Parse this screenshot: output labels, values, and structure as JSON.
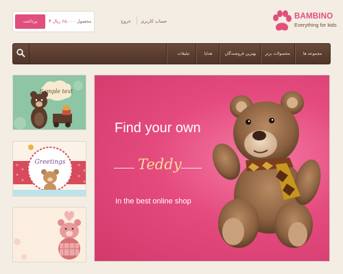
{
  "header": {
    "pay_label": "پرداخت",
    "cart_count": "۳ محصول",
    "cart_total": "۶۵,۰۰۰ ریال",
    "logout_label": "خروج",
    "account_label": "حساب کاربری",
    "logo_title": "BAMBINO",
    "logo_tagline": "Everything for kids"
  },
  "nav": {
    "items": [
      "مجموعه ها",
      "محصولات برتر",
      "بهترین فروشندگان",
      "هدایا",
      "تبلیغات"
    ]
  },
  "thumbs": {
    "sample_text": "Sample text",
    "greetings_text": "Greetings"
  },
  "hero": {
    "line1": "Find your own",
    "word": "Teddy",
    "line3": "In the best online shop"
  },
  "colors": {
    "accent": "#e04f7d",
    "nav_bg": "#5a3d30",
    "page_bg": "#f3ede3"
  }
}
